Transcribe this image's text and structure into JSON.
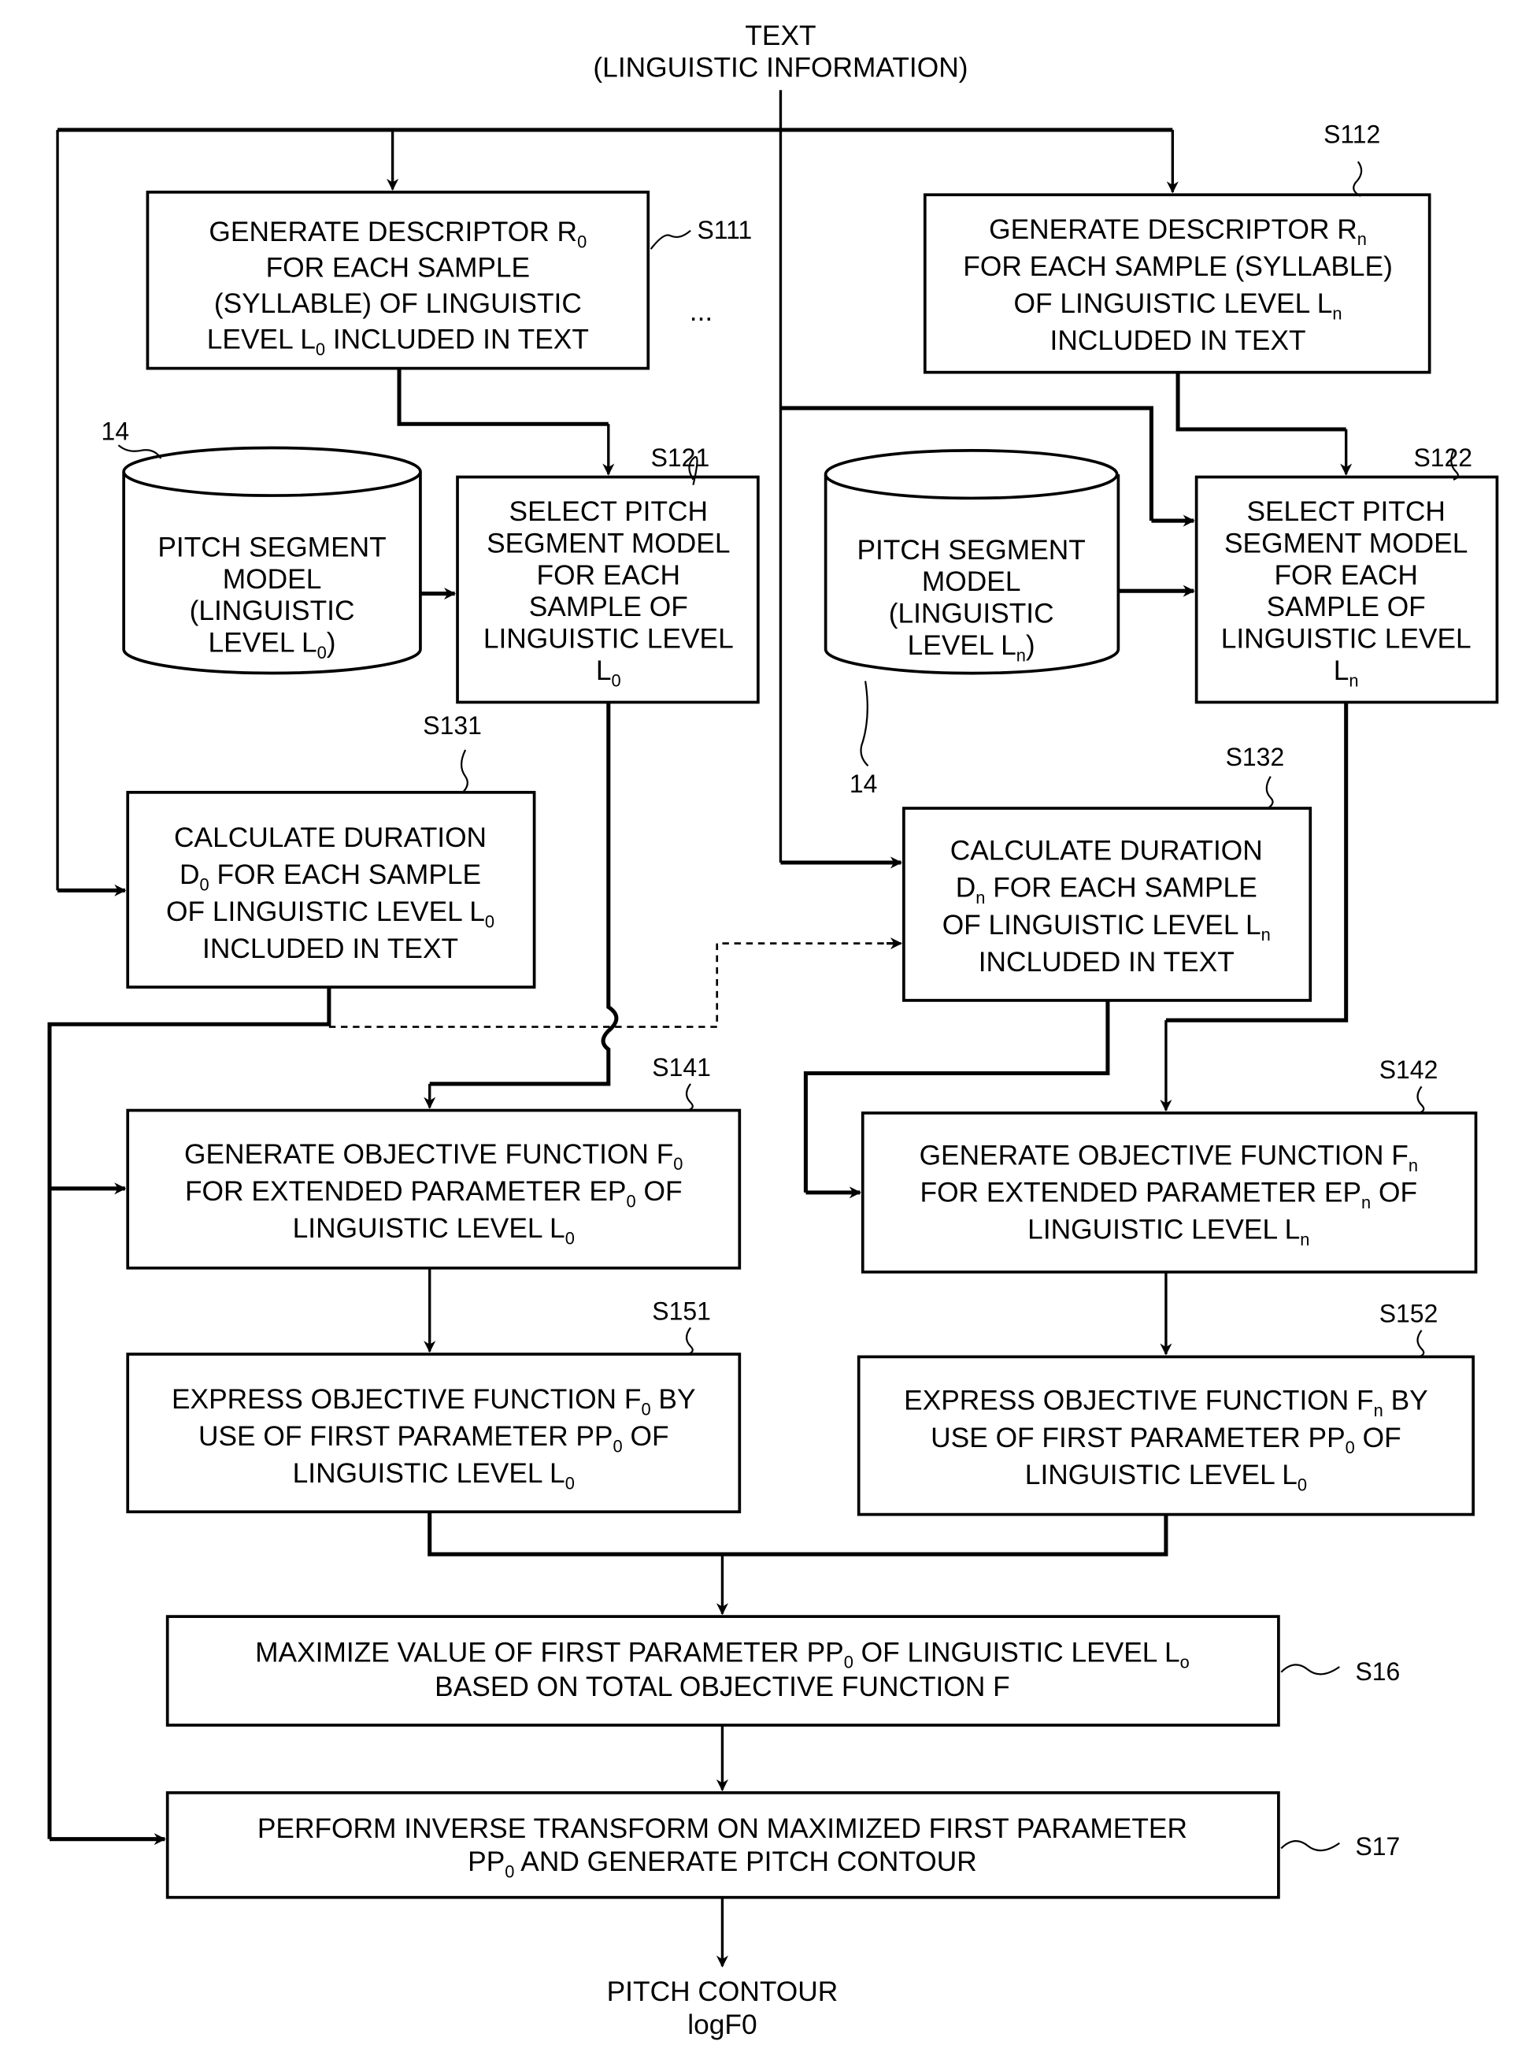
{
  "input": {
    "title": "TEXT",
    "subtitle": "(LINGUISTIC INFORMATION)"
  },
  "output": {
    "title": "PITCH CONTOUR",
    "subtitle": "logF0"
  },
  "ellipsis": "...",
  "database_ref": "14",
  "steps": {
    "s111": {
      "id": "S111",
      "lines": [
        [
          "GENERATE DESCRIPTOR R",
          "0",
          ""
        ],
        [
          "FOR EACH SAMPLE",
          "",
          ""
        ],
        [
          "(SYLLABLE) OF LINGUISTIC",
          "",
          ""
        ],
        [
          "LEVEL L",
          "0",
          " INCLUDED IN TEXT"
        ]
      ]
    },
    "s112": {
      "id": "S112",
      "lines": [
        [
          "GENERATE DESCRIPTOR R",
          "n",
          ""
        ],
        [
          "FOR EACH SAMPLE (SYLLABLE)",
          "",
          ""
        ],
        [
          "OF LINGUISTIC LEVEL L",
          "n",
          ""
        ],
        [
          "INCLUDED IN TEXT",
          "",
          ""
        ]
      ]
    },
    "s121": {
      "id": "S121",
      "lines": [
        [
          "SELECT PITCH",
          "",
          ""
        ],
        [
          "SEGMENT MODEL",
          "",
          ""
        ],
        [
          "FOR EACH",
          "",
          ""
        ],
        [
          "SAMPLE OF",
          "",
          ""
        ],
        [
          "LINGUISTIC LEVEL",
          "",
          ""
        ],
        [
          "L",
          "0",
          ""
        ]
      ]
    },
    "s122": {
      "id": "S122",
      "lines": [
        [
          "SELECT PITCH",
          "",
          ""
        ],
        [
          "SEGMENT MODEL",
          "",
          ""
        ],
        [
          "FOR EACH",
          "",
          ""
        ],
        [
          "SAMPLE OF",
          "",
          ""
        ],
        [
          "LINGUISTIC LEVEL",
          "",
          ""
        ],
        [
          "L",
          "n",
          ""
        ]
      ]
    },
    "s131": {
      "id": "S131",
      "lines": [
        [
          "CALCULATE DURATION",
          "",
          ""
        ],
        [
          "D",
          "0",
          " FOR EACH SAMPLE"
        ],
        [
          "OF LINGUISTIC LEVEL L",
          "0",
          ""
        ],
        [
          "INCLUDED IN TEXT",
          "",
          ""
        ]
      ]
    },
    "s132": {
      "id": "S132",
      "lines": [
        [
          "CALCULATE DURATION",
          "",
          ""
        ],
        [
          "D",
          "n",
          " FOR EACH SAMPLE"
        ],
        [
          "OF LINGUISTIC LEVEL L",
          "n",
          ""
        ],
        [
          "INCLUDED IN TEXT",
          "",
          ""
        ]
      ]
    },
    "s141": {
      "id": "S141",
      "lines": [
        [
          "GENERATE OBJECTIVE FUNCTION F",
          "0",
          ""
        ],
        [
          "FOR EXTENDED PARAMETER EP",
          "0",
          " OF"
        ],
        [
          "LINGUISTIC LEVEL L",
          "0",
          ""
        ]
      ]
    },
    "s142": {
      "id": "S142",
      "lines": [
        [
          "GENERATE OBJECTIVE FUNCTION F",
          "n",
          ""
        ],
        [
          "FOR EXTENDED PARAMETER EP",
          "n",
          " OF"
        ],
        [
          "LINGUISTIC LEVEL L",
          "n",
          ""
        ]
      ]
    },
    "s151": {
      "id": "S151",
      "lines": [
        [
          "EXPRESS OBJECTIVE FUNCTION F",
          "0",
          " BY"
        ],
        [
          "USE OF FIRST PARAMETER PP",
          "0",
          " OF"
        ],
        [
          "LINGUISTIC LEVEL L",
          "0",
          ""
        ]
      ]
    },
    "s152": {
      "id": "S152",
      "lines": [
        [
          "EXPRESS OBJECTIVE FUNCTION F",
          "n",
          " BY"
        ],
        [
          "USE OF FIRST PARAMETER PP",
          "0",
          " OF"
        ],
        [
          "LINGUISTIC LEVEL L",
          "0",
          ""
        ]
      ]
    },
    "s16": {
      "id": "S16",
      "lines": [
        [
          "MAXIMIZE VALUE OF FIRST PARAMETER PP",
          "0",
          " OF LINGUISTIC LEVEL L",
          "o"
        ],
        [
          "BASED ON TOTAL OBJECTIVE FUNCTION F",
          "",
          ""
        ]
      ]
    },
    "s17": {
      "id": "S17",
      "lines": [
        [
          "PERFORM INVERSE TRANSFORM ON MAXIMIZED FIRST PARAMETER",
          "",
          ""
        ],
        [
          "PP",
          "0",
          " AND GENERATE PITCH CONTOUR"
        ]
      ]
    }
  },
  "databases": {
    "db0": {
      "lines": [
        [
          "PITCH SEGMENT",
          "",
          ""
        ],
        [
          "MODEL",
          "",
          ""
        ],
        [
          "(LINGUISTIC",
          "",
          ""
        ],
        [
          "LEVEL L",
          "0",
          ")"
        ]
      ]
    },
    "dbn": {
      "lines": [
        [
          "PITCH SEGMENT",
          "",
          ""
        ],
        [
          "MODEL",
          "",
          ""
        ],
        [
          "(LINGUISTIC",
          "",
          ""
        ],
        [
          "LEVEL L",
          "n",
          ")"
        ]
      ]
    }
  }
}
